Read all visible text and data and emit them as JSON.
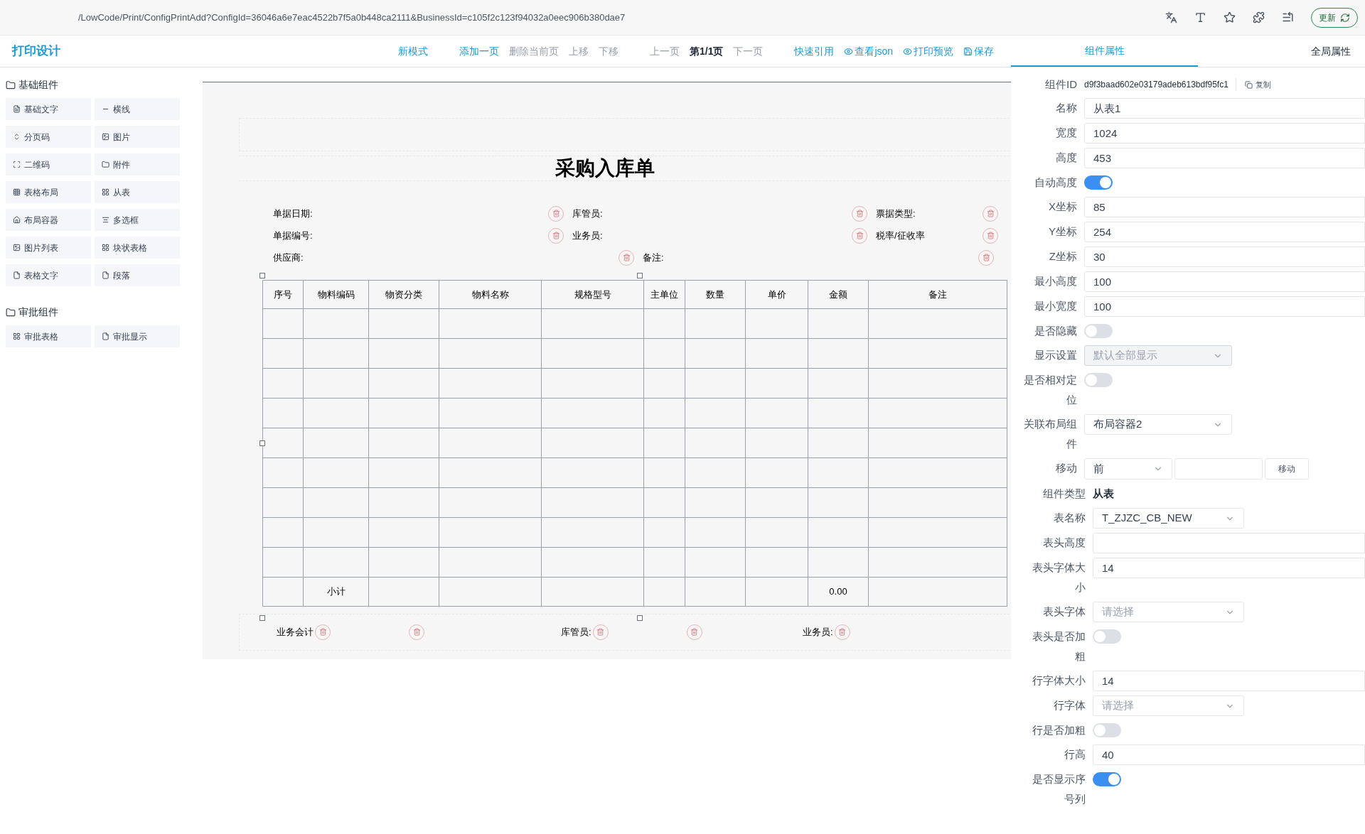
{
  "browser": {
    "url": "/LowCode/Print/ConfigPrintAdd?ConfigId=36046a6e7eac4522b7f5a0b448ca2111&BusinessId=c105f2c123f94032a0eec906b380dae7",
    "update_button": "更新"
  },
  "app_title": "打印设计",
  "toolbar": [
    {
      "label": "新模式",
      "kind": "link",
      "disabled": false
    },
    {
      "label": "添加一页",
      "kind": "link",
      "disabled": false
    },
    {
      "label": "删除当前页",
      "kind": "link",
      "disabled": true
    },
    {
      "label": "上移",
      "kind": "link",
      "disabled": true
    },
    {
      "label": "下移",
      "kind": "link",
      "disabled": true
    },
    {
      "label": "上一页",
      "kind": "link",
      "disabled": true
    },
    {
      "label": "第1/1页",
      "kind": "page",
      "disabled": false
    },
    {
      "label": "下一页",
      "kind": "link",
      "disabled": true
    },
    {
      "label": "快速引用",
      "kind": "link",
      "disabled": false
    },
    {
      "label": "查看json",
      "kind": "eye",
      "disabled": false
    },
    {
      "label": "打印预览",
      "kind": "eye",
      "disabled": false
    },
    {
      "label": "保存",
      "kind": "save",
      "disabled": false
    }
  ],
  "panel_tabs": [
    {
      "label": "组件属性",
      "selected": true
    },
    {
      "label": "全局属性",
      "selected": false
    }
  ],
  "sidebar": [
    {
      "title": "基础组件",
      "items": [
        "基础文字",
        "横线",
        "分页码",
        "图片",
        "二维码",
        "附件",
        "表格布局",
        "从表",
        "布局容器",
        "多选框",
        "图片列表",
        "块状表格",
        "表格文字",
        "段落"
      ]
    },
    {
      "title": "审批组件",
      "items": [
        "审批表格",
        "审批显示"
      ]
    }
  ],
  "document": {
    "title": "采购入库单",
    "header_fields": [
      [
        "单据日期:",
        "库管员:",
        "票据类型:"
      ],
      [
        "单据编号:",
        "业务员:",
        "税率/征收率"
      ],
      [
        "供应商:",
        "备注:"
      ]
    ],
    "columns": [
      {
        "label": "序号",
        "kind": "index"
      },
      {
        "label": "物料编码",
        "kind": "text"
      },
      {
        "label": "物资分类",
        "kind": "text"
      },
      {
        "label": "物料名称",
        "kind": "text"
      },
      {
        "label": "规格型号",
        "kind": "text"
      },
      {
        "label": "主单位",
        "kind": "text"
      },
      {
        "label": "数量",
        "kind": "text"
      },
      {
        "label": "单价",
        "kind": "text"
      },
      {
        "label": "金额",
        "kind": "amount"
      },
      {
        "label": "备注",
        "kind": "text"
      }
    ],
    "summary_row": {
      "label": "小计",
      "amount": "0.00"
    },
    "footer_fields": [
      "业务会计",
      "库管员:",
      "业务员:"
    ]
  },
  "component_id": {
    "label": "组件ID",
    "value": "d9f3baad602e03179adeb613bdf95fc1",
    "copy_button": "复制"
  },
  "properties": [
    {
      "kind": "text",
      "label": "名称",
      "value": "从表1"
    },
    {
      "kind": "text",
      "label": "宽度",
      "value": "1024"
    },
    {
      "kind": "text",
      "label": "高度",
      "value": "453"
    },
    {
      "kind": "toggle",
      "label": "自动高度",
      "on": true
    },
    {
      "kind": "text",
      "label": "X坐标",
      "value": "85"
    },
    {
      "kind": "text",
      "label": "Y坐标",
      "value": "254"
    },
    {
      "kind": "text",
      "label": "Z坐标",
      "value": "30"
    },
    {
      "kind": "text",
      "label": "最小高度",
      "value": "100"
    },
    {
      "kind": "text",
      "label": "最小宽度",
      "value": "100"
    },
    {
      "kind": "toggle",
      "label": "是否隐藏",
      "on": false
    },
    {
      "kind": "select",
      "label": "显示设置",
      "value": "默认全部显示",
      "disabled": true
    },
    {
      "kind": "toggle",
      "label": "是否相对定位",
      "on": false
    },
    {
      "kind": "select",
      "label": "关联布局组件",
      "value": "布局容器2",
      "disabled": false
    },
    {
      "kind": "move",
      "label": "移动",
      "value": "前",
      "button": "移动"
    }
  ],
  "table_properties": [
    {
      "kind": "static",
      "label": "组件类型",
      "value": "从表"
    },
    {
      "kind": "select",
      "label": "表名称",
      "value": "T_ZJZC_CB_NEW",
      "disabled": false
    },
    {
      "kind": "text",
      "label": "表头高度"
    },
    {
      "kind": "text",
      "label": "表头字体大小",
      "value": "14"
    },
    {
      "kind": "select",
      "label": "表头字体",
      "placeholder": "请选择",
      "disabled": false
    },
    {
      "kind": "toggle",
      "label": "表头是否加粗",
      "on": false
    },
    {
      "kind": "text",
      "label": "行字体大小",
      "value": "14"
    },
    {
      "kind": "select",
      "label": "行字体",
      "placeholder": "请选择",
      "disabled": false
    },
    {
      "kind": "toggle",
      "label": "行是否加粗",
      "on": false
    },
    {
      "kind": "text",
      "label": "行高",
      "value": "40"
    },
    {
      "kind": "toggle",
      "label": "是否显示序号列",
      "on": true
    }
  ]
}
